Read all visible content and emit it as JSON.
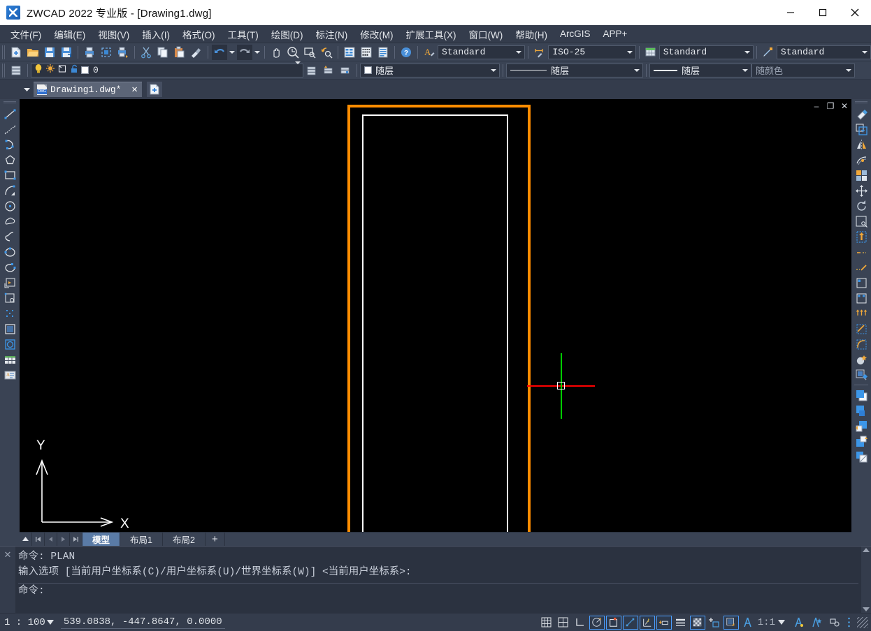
{
  "titlebar": {
    "title": "ZWCAD 2022 专业版 - [Drawing1.dwg]",
    "app_icon": "zwcad-logo-icon",
    "minimize_label": "–",
    "maximize_label": "□",
    "close_label": "✕"
  },
  "menubar": {
    "items": [
      {
        "label": "文件(F)",
        "name": "menu-file"
      },
      {
        "label": "编辑(E)",
        "name": "menu-edit"
      },
      {
        "label": "视图(V)",
        "name": "menu-view"
      },
      {
        "label": "插入(I)",
        "name": "menu-insert"
      },
      {
        "label": "格式(O)",
        "name": "menu-format"
      },
      {
        "label": "工具(T)",
        "name": "menu-tools"
      },
      {
        "label": "绘图(D)",
        "name": "menu-draw"
      },
      {
        "label": "标注(N)",
        "name": "menu-dimension"
      },
      {
        "label": "修改(M)",
        "name": "menu-modify"
      },
      {
        "label": "扩展工具(X)",
        "name": "menu-express-tools"
      },
      {
        "label": "窗口(W)",
        "name": "menu-window"
      },
      {
        "label": "帮助(H)",
        "name": "menu-help"
      },
      {
        "label": "ArcGIS",
        "name": "menu-arcgis"
      },
      {
        "label": "APP+",
        "name": "menu-app-plus"
      }
    ]
  },
  "toolbar1": {
    "buttons": [
      "new-icon",
      "open-icon",
      "save-icon",
      "save-as-icon",
      "plot-icon",
      "plot-preview-icon",
      "publish-icon",
      "cut-icon",
      "copy-icon",
      "paste-icon",
      "match-properties-icon",
      "undo-icon",
      "redo-icon",
      "pan-icon",
      "zoom-realtime-icon",
      "zoom-window-icon",
      "zoom-previous-icon",
      "properties-icon",
      "design-center-icon",
      "tool-palette-icon",
      "help-icon"
    ],
    "combos": [
      {
        "name": "text-style-combo",
        "icon": "text-style-icon",
        "value": "Standard"
      },
      {
        "name": "dim-style-combo",
        "icon": "dim-style-icon",
        "value": "ISO-25"
      },
      {
        "name": "table-style-combo",
        "icon": "table-style-icon",
        "value": "Standard"
      },
      {
        "name": "mleader-style-combo",
        "icon": "mleader-style-icon",
        "value": "Standard"
      }
    ]
  },
  "toolbar2": {
    "layer_manager_icon": "layer-properties-icon",
    "layer": {
      "name_value": "0",
      "state_icons": [
        "lightbulb-on-icon",
        "sun-freeze-icon",
        "lock-unlocked-icon",
        "plot-icon"
      ],
      "color_swatch": "#ffffff"
    },
    "after_buttons": [
      "layer-previous-icon",
      "layer-state-icon",
      "layer-isolate-icon"
    ],
    "color_combo": {
      "name": "color-control-combo",
      "value": "随层",
      "swatch": "#ffffff"
    },
    "linetype_combo": {
      "name": "linetype-control-combo",
      "value": "随层"
    },
    "lineweight_combo": {
      "name": "lineweight-control-combo",
      "value": "随层"
    },
    "plotstyle_combo": {
      "name": "plot-style-control-combo",
      "value": "随颜色"
    }
  },
  "docbar": {
    "tab_label": "Drawing1.dwg*",
    "tab_icon": "dwg-file-icon",
    "tab_badge": "DWG",
    "close_label": "✕",
    "new_tab_icon": "new-drawing-icon",
    "dropdown_icon": "chevron-down-icon"
  },
  "left_toolbar": {
    "buttons": [
      "line-icon",
      "construction-line-icon",
      "polyline-icon",
      "polygon-icon",
      "rectangle-icon",
      "arc-icon",
      "circle-icon",
      "revision-cloud-icon",
      "spline-icon",
      "ellipse-icon",
      "ellipse-arc-icon",
      "insert-block-icon",
      "make-block-icon",
      "point-icon",
      "hatch-icon",
      "gradient-icon",
      "table-icon",
      "multiline-text-icon"
    ]
  },
  "right_toolbar": {
    "buttons": [
      "erase-icon",
      "copy-object-icon",
      "mirror-icon",
      "offset-icon",
      "array-icon",
      "move-icon",
      "rotate-icon",
      "scale-icon",
      "stretch-icon",
      "trim-icon",
      "extend-icon",
      "break-at-point-icon",
      "break-icon",
      "join-icon",
      "chamfer-icon",
      "fillet-icon",
      "explode-icon",
      "edit-hatch-icon",
      "bring-to-front-icon",
      "send-to-back-icon",
      "bring-above-object-icon",
      "send-under-object-icon",
      "draw-order-icon"
    ]
  },
  "canvas": {
    "mdi_minimize": "–",
    "mdi_restore": "❐",
    "mdi_close": "✕",
    "selection_rect_color": "#ff8c00",
    "drawing_rect_color": "#ffffff",
    "crosshair_h_color": "#ff0000",
    "crosshair_v_color": "#00cc00",
    "ucs_x_label": "X",
    "ucs_y_label": "Y"
  },
  "model_tabs": {
    "nav": [
      "collapse-icon",
      "first-layout-icon",
      "prev-layout-icon",
      "next-layout-icon",
      "last-layout-icon"
    ],
    "tabs": [
      {
        "label": "模型",
        "active": true,
        "name": "tab-model"
      },
      {
        "label": "布局1",
        "active": false,
        "name": "tab-layout1"
      },
      {
        "label": "布局2",
        "active": false,
        "name": "tab-layout2"
      }
    ],
    "add_label": "+"
  },
  "command_window": {
    "close_label": "✕",
    "lines": [
      "命令: PLAN",
      "输入选项 [当前用户坐标系(C)/用户坐标系(U)/世界坐标系(W)] <当前用户坐标系>:"
    ],
    "prompt": "命令:"
  },
  "statusbar": {
    "scale": "1 : 100",
    "coords": "539.0838,  -447.8647,  0.0000",
    "toggles": [
      {
        "name": "snap-toggle",
        "icon": "snap-grid-icon",
        "on": false
      },
      {
        "name": "grid-toggle",
        "icon": "grid-icon",
        "on": false
      },
      {
        "name": "ortho-toggle",
        "icon": "ortho-icon",
        "on": false
      },
      {
        "name": "polar-toggle",
        "icon": "polar-tracking-icon",
        "on": true
      },
      {
        "name": "osnap-toggle",
        "icon": "object-snap-icon",
        "on": true
      },
      {
        "name": "otrack-toggle",
        "icon": "object-snap-tracking-icon",
        "on": true
      },
      {
        "name": "ducs-toggle",
        "icon": "dynamic-ucs-icon",
        "on": true
      },
      {
        "name": "dyn-toggle",
        "icon": "dynamic-input-icon",
        "on": true
      },
      {
        "name": "lwt-toggle",
        "icon": "lineweight-icon",
        "on": false
      },
      {
        "name": "transparency-toggle",
        "icon": "transparency-icon",
        "on": true
      },
      {
        "name": "quick-properties-toggle",
        "icon": "quick-properties-icon",
        "on": false
      },
      {
        "name": "selection-cycling-toggle",
        "icon": "selection-cycling-icon",
        "on": true
      }
    ],
    "annotation_scale": "1:1",
    "right_icons": [
      "annotation-visibility-icon",
      "auto-scale-icon",
      "workspace-icon",
      "customize-icon"
    ],
    "resizer_icon": "resize-grip-icon"
  }
}
